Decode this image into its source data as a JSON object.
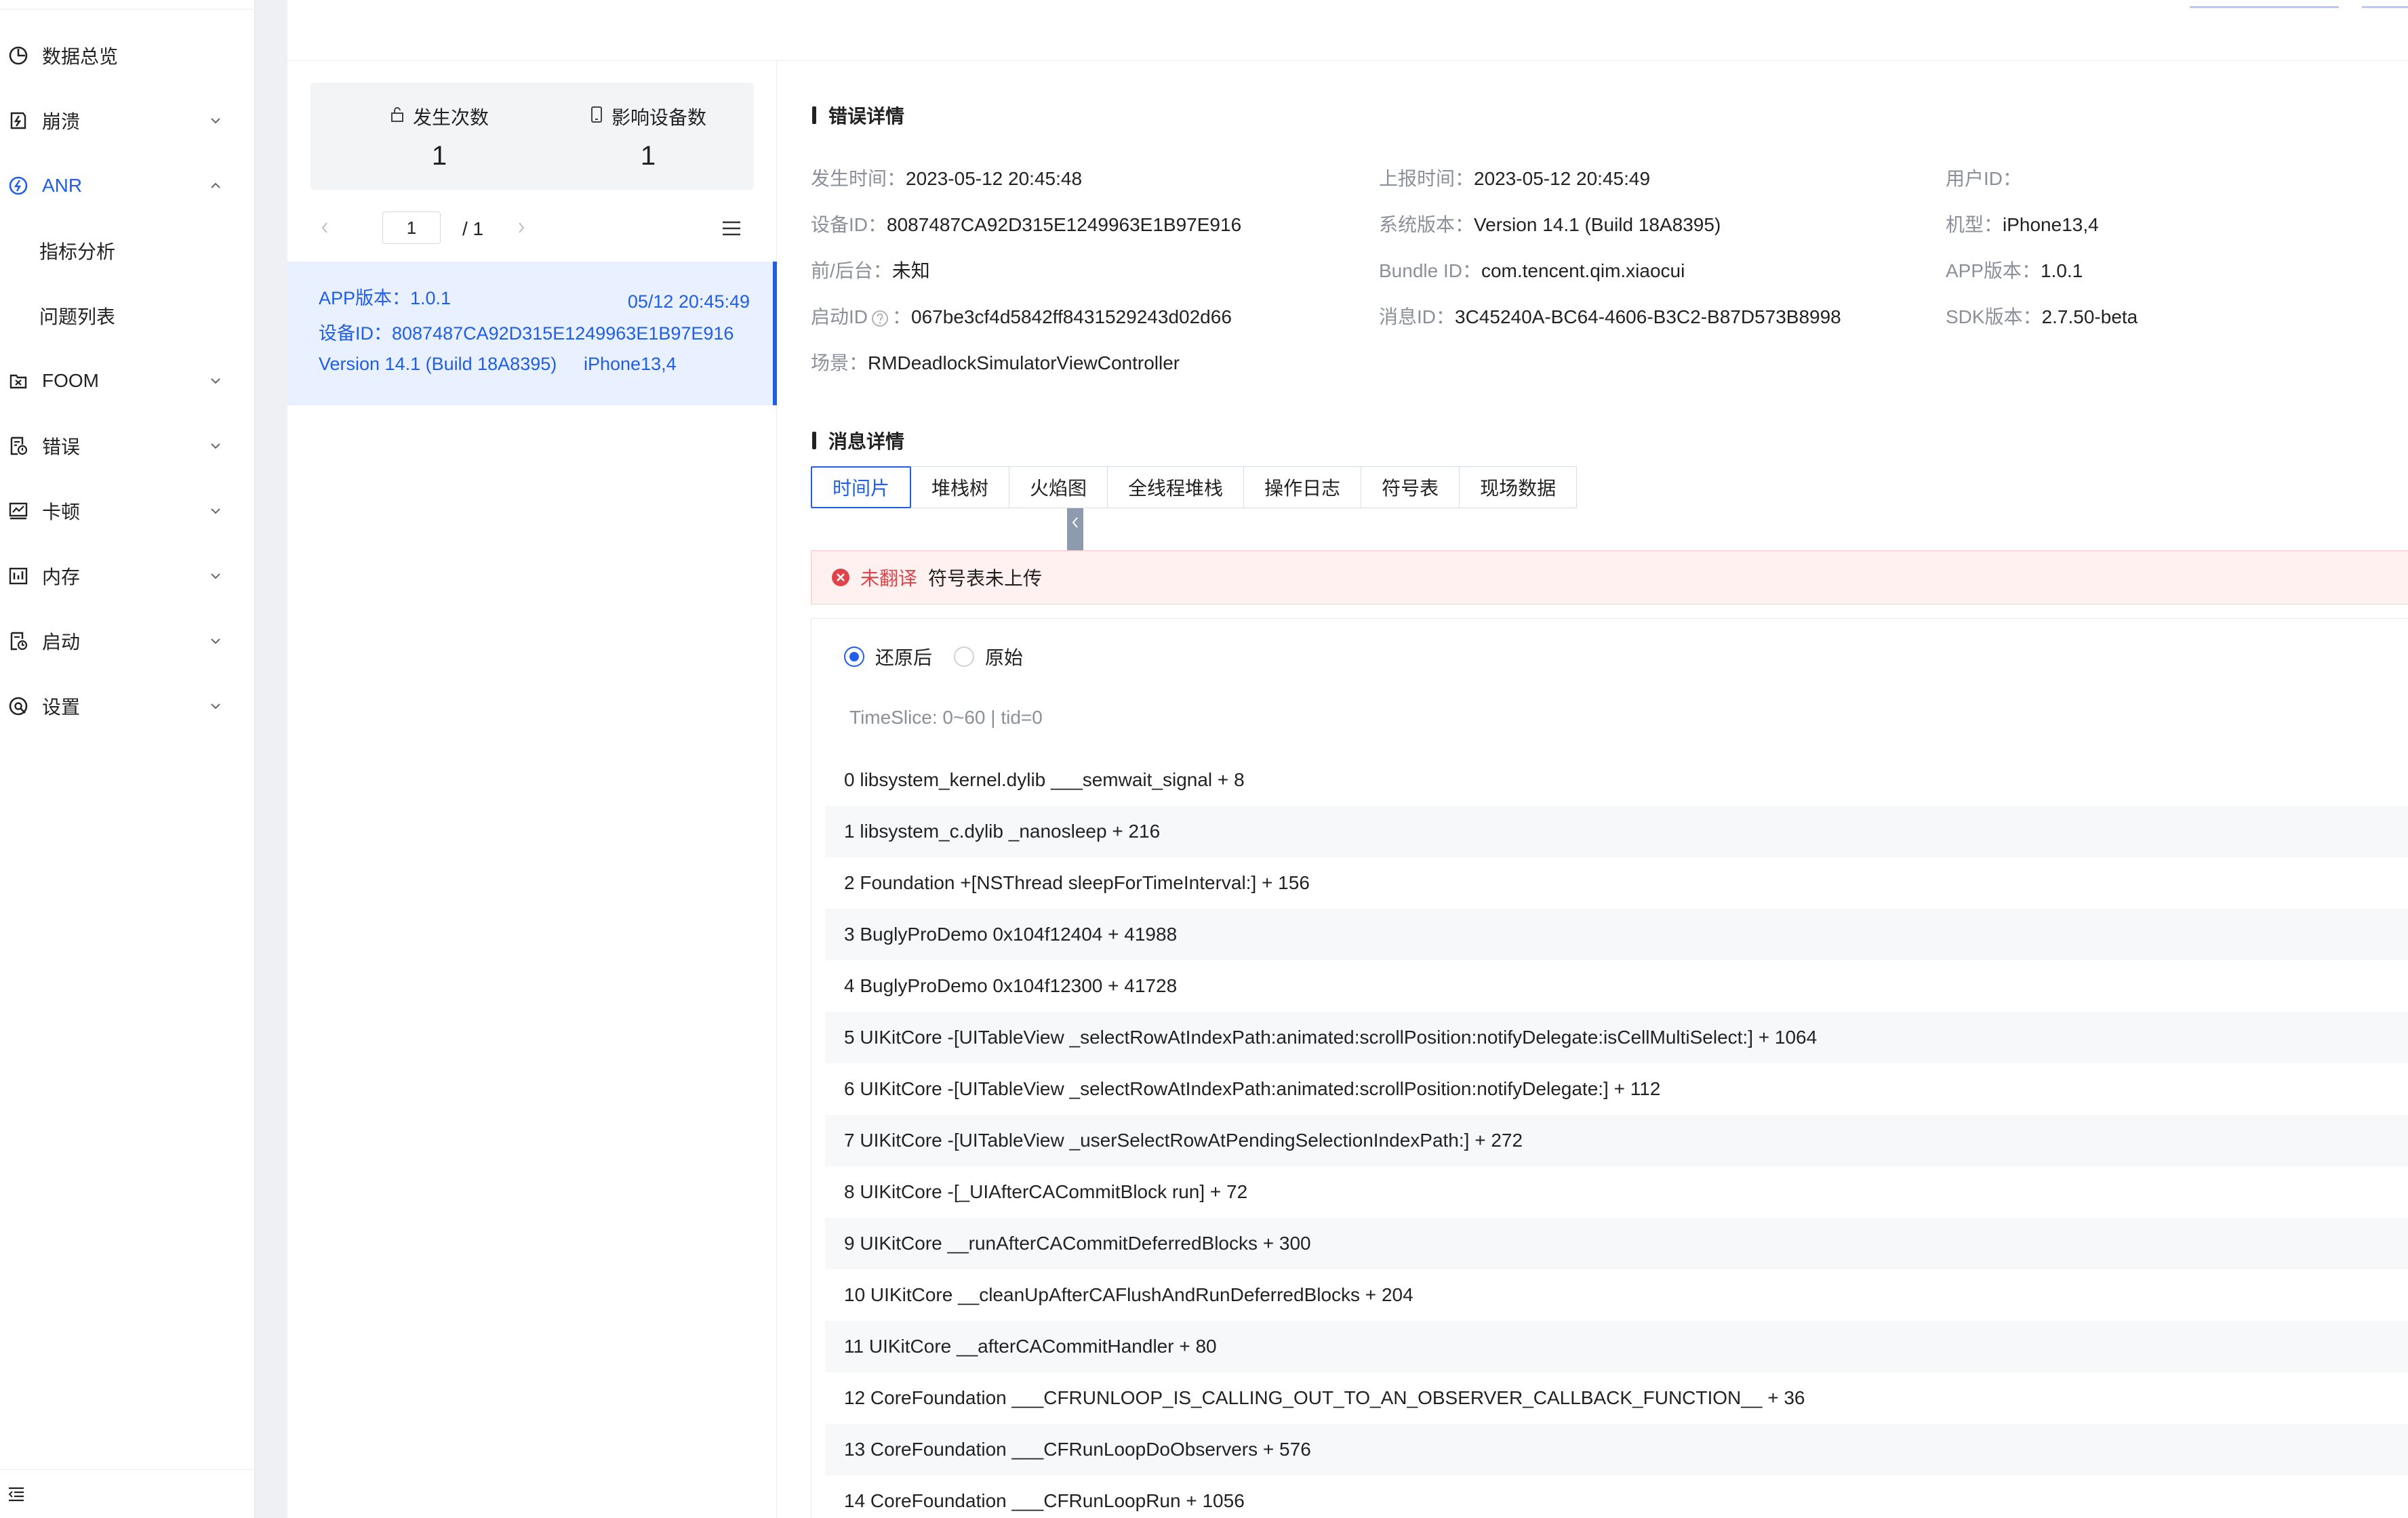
{
  "sidebar": {
    "items": [
      {
        "label": "数据总览",
        "icon": "pie-chart-icon",
        "expandable": false,
        "top": 0
      },
      {
        "label": "崩溃",
        "icon": "crash-icon",
        "expandable": true
      },
      {
        "label": "ANR",
        "icon": "anr-icon",
        "expandable": true,
        "active": true
      },
      {
        "label": "FOOM",
        "icon": "foom-icon",
        "expandable": true
      },
      {
        "label": "错误",
        "icon": "error-doc-icon",
        "expandable": true
      },
      {
        "label": "卡顿",
        "icon": "lag-chart-icon",
        "expandable": true
      },
      {
        "label": "内存",
        "icon": "memory-icon",
        "expandable": true
      },
      {
        "label": "启动",
        "icon": "launch-icon",
        "expandable": true
      },
      {
        "label": "设置",
        "icon": "settings-icon",
        "expandable": true
      }
    ],
    "anr_children": [
      {
        "label": "指标分析"
      },
      {
        "label": "问题列表"
      }
    ],
    "accent_color": "#1f5eea"
  },
  "list_panel": {
    "stats": [
      {
        "label": "发生次数",
        "value": "1",
        "icon": "lock-icon"
      },
      {
        "label": "影响设备数",
        "value": "1",
        "icon": "device-icon"
      }
    ],
    "pager": {
      "current": "1",
      "total": "/ 1"
    },
    "items": [
      {
        "app_version": "APP版本：1.0.1",
        "date": "05/12 20:45:49",
        "device_id": "设备ID：8087487CA92D315E1249963E1B97E916",
        "system_version": "Version 14.1 (Build 18A8395)",
        "model": "iPhone13,4"
      }
    ]
  },
  "error_details": {
    "title": "错误详情",
    "fields": [
      {
        "key": "发生时间：",
        "value": "2023-05-12 20:45:48"
      },
      {
        "key": "上报时间：",
        "value": "2023-05-12 20:45:49"
      },
      {
        "key": "用户ID：",
        "value": ""
      },
      {
        "key": "设备ID：",
        "value": "8087487CA92D315E1249963E1B97E916"
      },
      {
        "key": "系统版本：",
        "value": "Version 14.1 (Build 18A8395)"
      },
      {
        "key": "机型：",
        "value": "iPhone13,4"
      },
      {
        "key": "前/后台：",
        "value": "未知"
      },
      {
        "key": "Bundle ID：",
        "value": "com.tencent.qim.xiaocui"
      },
      {
        "key": "APP版本：",
        "value": "1.0.1"
      },
      {
        "key": "启动ID",
        "value": "067be3cf4d5842ff8431529243d02d66",
        "key_suffix": "："
      },
      {
        "key": "消息ID：",
        "value": "3C45240A-BC64-4606-B3C2-B87D573B8998"
      },
      {
        "key": "SDK版本：",
        "value": "2.7.50-beta"
      },
      {
        "key": "场景：",
        "value": "RMDeadlockSimulatorViewController"
      }
    ]
  },
  "message_details": {
    "title": "消息详情",
    "tabs": [
      "时间片",
      "堆栈树",
      "火焰图",
      "全线程堆栈",
      "操作日志",
      "符号表",
      "现场数据"
    ],
    "active_tab": 0,
    "alert": {
      "tag": "未翻译",
      "message": "符号表未上传",
      "color": "#e0444a"
    },
    "radios": [
      {
        "label": "还原后",
        "checked": true
      },
      {
        "label": "原始",
        "checked": false
      }
    ],
    "timeslice": "TimeSlice: 0~60 | tid=0",
    "frames": [
      "0 libsystem_kernel.dylib ___semwait_signal + 8",
      "1 libsystem_c.dylib _nanosleep + 216",
      "2 Foundation +[NSThread sleepForTimeInterval:] + 156",
      "3 BuglyProDemo 0x104f12404 + 41988",
      "4 BuglyProDemo 0x104f12300 + 41728",
      "5 UIKitCore -[UITableView _selectRowAtIndexPath:animated:scrollPosition:notifyDelegate:isCellMultiSelect:] + 1064",
      "6 UIKitCore -[UITableView _selectRowAtIndexPath:animated:scrollPosition:notifyDelegate:] + 112",
      "7 UIKitCore -[UITableView _userSelectRowAtPendingSelectionIndexPath:] + 272",
      "8 UIKitCore -[_UIAfterCACommitBlock run] + 72",
      "9 UIKitCore __runAfterCACommitDeferredBlocks + 300",
      "10 UIKitCore __cleanUpAfterCAFlushAndRunDeferredBlocks + 204",
      "11 UIKitCore __afterCACommitHandler + 80",
      "12 CoreFoundation ___CFRUNLOOP_IS_CALLING_OUT_TO_AN_OBSERVER_CALLBACK_FUNCTION__ + 36",
      "13 CoreFoundation ___CFRunLoopDoObservers + 576",
      "14 CoreFoundation ___CFRunLoopRun + 1056"
    ]
  }
}
